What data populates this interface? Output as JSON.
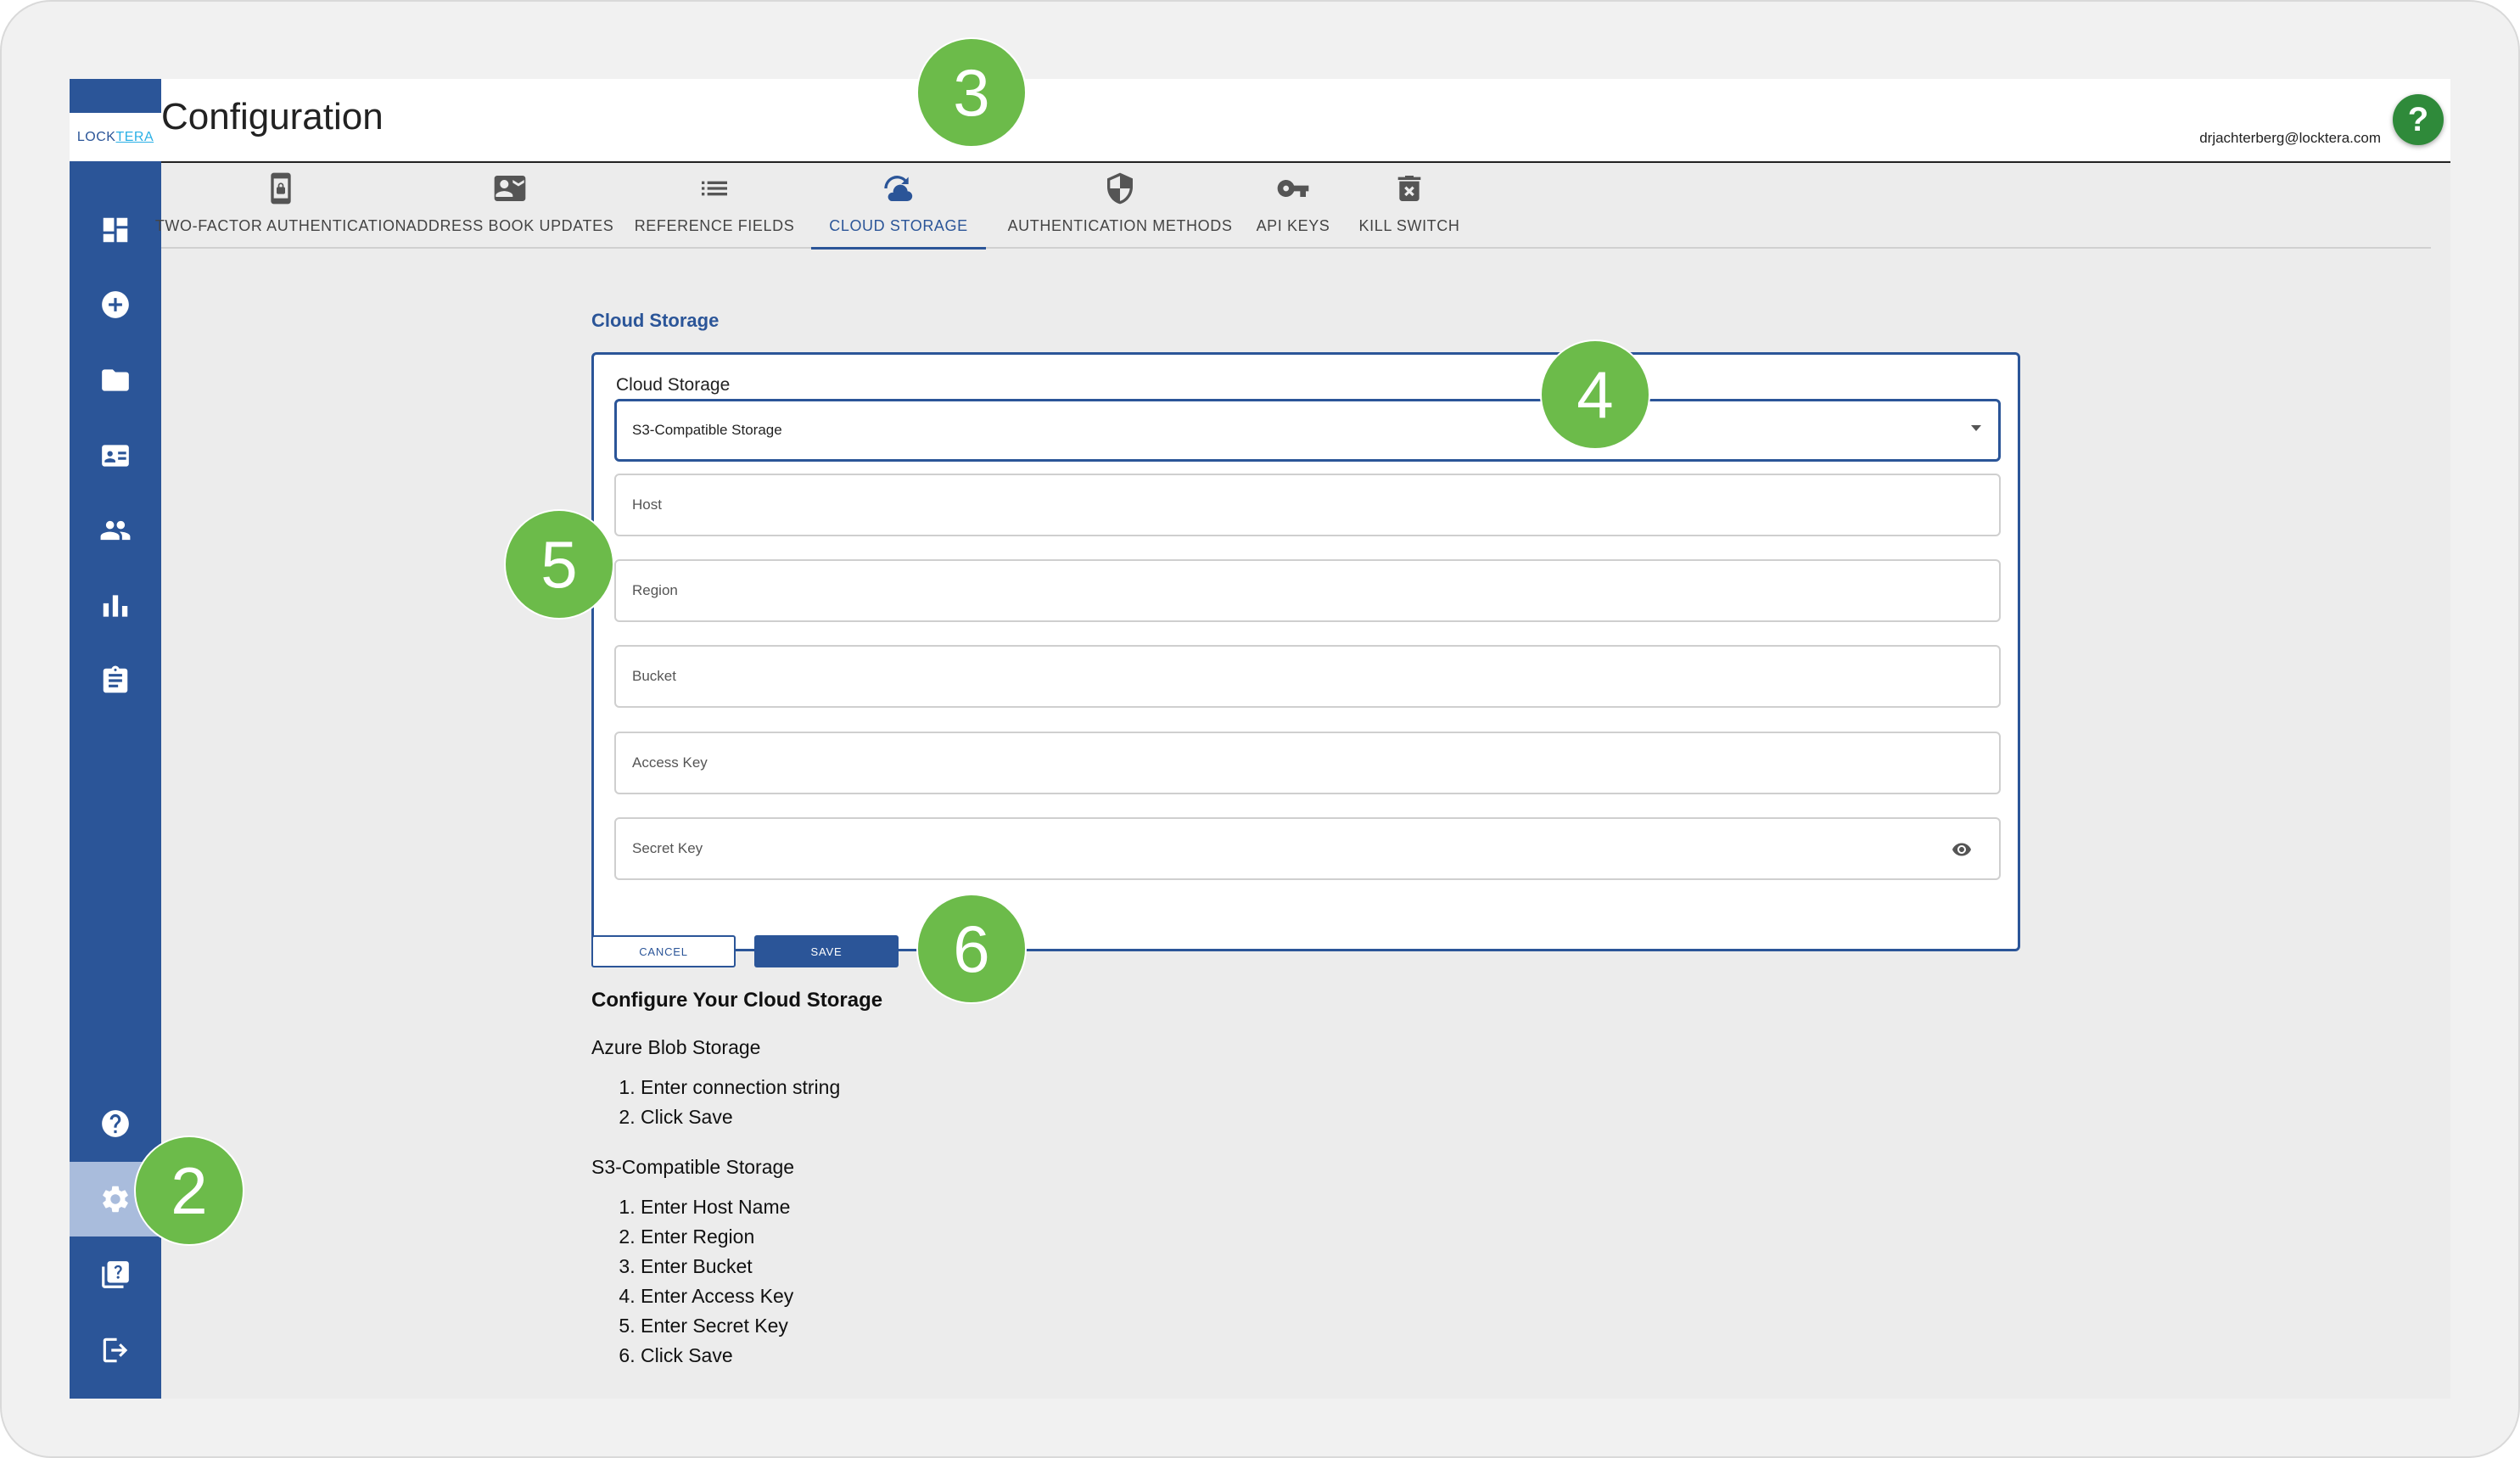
{
  "app": {
    "brand_lock": "LOCK",
    "brand_tera": "TERA",
    "page_title": "Configuration",
    "user_email": "drjachterberg@locktera.com",
    "help_label": "?"
  },
  "sidebar": {
    "items": [
      {
        "name": "dashboard",
        "icon": "dashboard-icon"
      },
      {
        "name": "create",
        "icon": "add-circle-icon"
      },
      {
        "name": "files",
        "icon": "folder-icon"
      },
      {
        "name": "contacts",
        "icon": "contact-card-icon"
      },
      {
        "name": "users",
        "icon": "people-icon"
      },
      {
        "name": "reports",
        "icon": "bar-chart-icon"
      },
      {
        "name": "audit",
        "icon": "clipboard-icon"
      },
      {
        "name": "help",
        "icon": "help-circle-icon"
      },
      {
        "name": "settings",
        "icon": "gear-icon",
        "active": true
      },
      {
        "name": "documentation",
        "icon": "help-book-icon"
      },
      {
        "name": "logout",
        "icon": "logout-icon"
      }
    ]
  },
  "tabs": [
    {
      "label": "TWO-FACTOR AUTHENTICATION",
      "icon": "phone-lock-icon"
    },
    {
      "label": "ADDRESS BOOK UPDATES",
      "icon": "contact-mail-icon"
    },
    {
      "label": "REFERENCE FIELDS",
      "icon": "list-icon"
    },
    {
      "label": "CLOUD STORAGE",
      "icon": "cloud-sync-icon",
      "active": true
    },
    {
      "label": "AUTHENTICATION METHODS",
      "icon": "shield-icon"
    },
    {
      "label": "API KEYS",
      "icon": "key-icon"
    },
    {
      "label": "KILL SWITCH",
      "icon": "trash-x-icon"
    }
  ],
  "form": {
    "section_title": "Cloud Storage",
    "select_label": "Cloud Storage",
    "select_value": "S3-Compatible Storage",
    "fields": {
      "host": "Host",
      "region": "Region",
      "bucket": "Bucket",
      "access_key": "Access Key",
      "secret_key": "Secret Key"
    },
    "cancel_label": "CANCEL",
    "save_label": "SAVE"
  },
  "instructions": {
    "heading": "Configure Your Cloud Storage",
    "azure_title": "Azure Blob Storage",
    "azure_steps": [
      "Enter connection string",
      "Click Save"
    ],
    "s3_title": "S3-Compatible Storage",
    "s3_steps": [
      "Enter Host Name",
      "Enter Region",
      "Enter Bucket",
      "Enter Access Key",
      "Enter Secret Key",
      "Click Save"
    ]
  },
  "callouts": {
    "c2": "2",
    "c3": "3",
    "c4": "4",
    "c5": "5",
    "c6": "6"
  },
  "colors": {
    "brand_blue": "#2b5598",
    "callout_green": "#6cbb4a",
    "help_green": "#2f8a3a"
  }
}
